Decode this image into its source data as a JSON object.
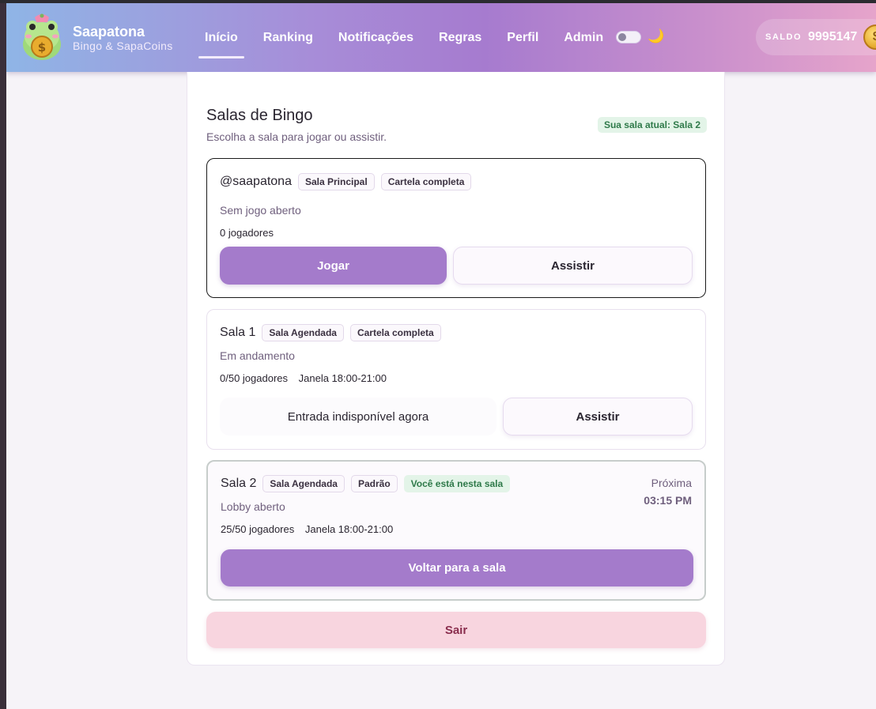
{
  "brand": {
    "title": "Saapatona",
    "subtitle": "Bingo & SapaCoins"
  },
  "nav": [
    {
      "label": "Início",
      "active": true
    },
    {
      "label": "Ranking",
      "active": false
    },
    {
      "label": "Notificações",
      "active": false
    },
    {
      "label": "Regras",
      "active": false
    },
    {
      "label": "Perfil",
      "active": false
    },
    {
      "label": "Admin",
      "active": false
    }
  ],
  "theme_toggle": {
    "icon": "moon-icon",
    "glyph": "🌙"
  },
  "balance": {
    "label": "SALDO",
    "value": "9995147",
    "coin_glyph": "$"
  },
  "section": {
    "title": "Salas de Bingo",
    "subtitle": "Escolha a sala para jogar ou assistir.",
    "current_room": "Sua sala atual: Sala 2"
  },
  "rooms": [
    {
      "name": "@saapatona",
      "chips": [
        "Sala Principal",
        "Cartela completa"
      ],
      "status": "Sem jogo aberto",
      "players": "0 jogadores",
      "primary_button": "Jogar",
      "secondary_button": "Assistir"
    },
    {
      "name": "Sala 1",
      "chips": [
        "Sala Agendada",
        "Cartela completa"
      ],
      "status": "Em andamento",
      "players": "0/50 jogadores",
      "window": "Janela 18:00-21:00",
      "unavailable": "Entrada indisponível agora",
      "secondary_button": "Assistir"
    },
    {
      "name": "Sala 2",
      "chips": [
        "Sala Agendada",
        "Padrão"
      ],
      "here_chip": "Você está nesta sala",
      "status": "Lobby aberto",
      "players": "25/50 jogadores",
      "window": "Janela 18:00-21:00",
      "next_label": "Próxima",
      "next_time": "03:15 PM",
      "primary_button": "Voltar para a sala"
    }
  ],
  "logout": "Sair",
  "colors": {
    "accent": "#a47bcb",
    "success_bg": "#e3f4e8",
    "success_text": "#2f7a4a",
    "logout_bg": "#f8d5df"
  }
}
